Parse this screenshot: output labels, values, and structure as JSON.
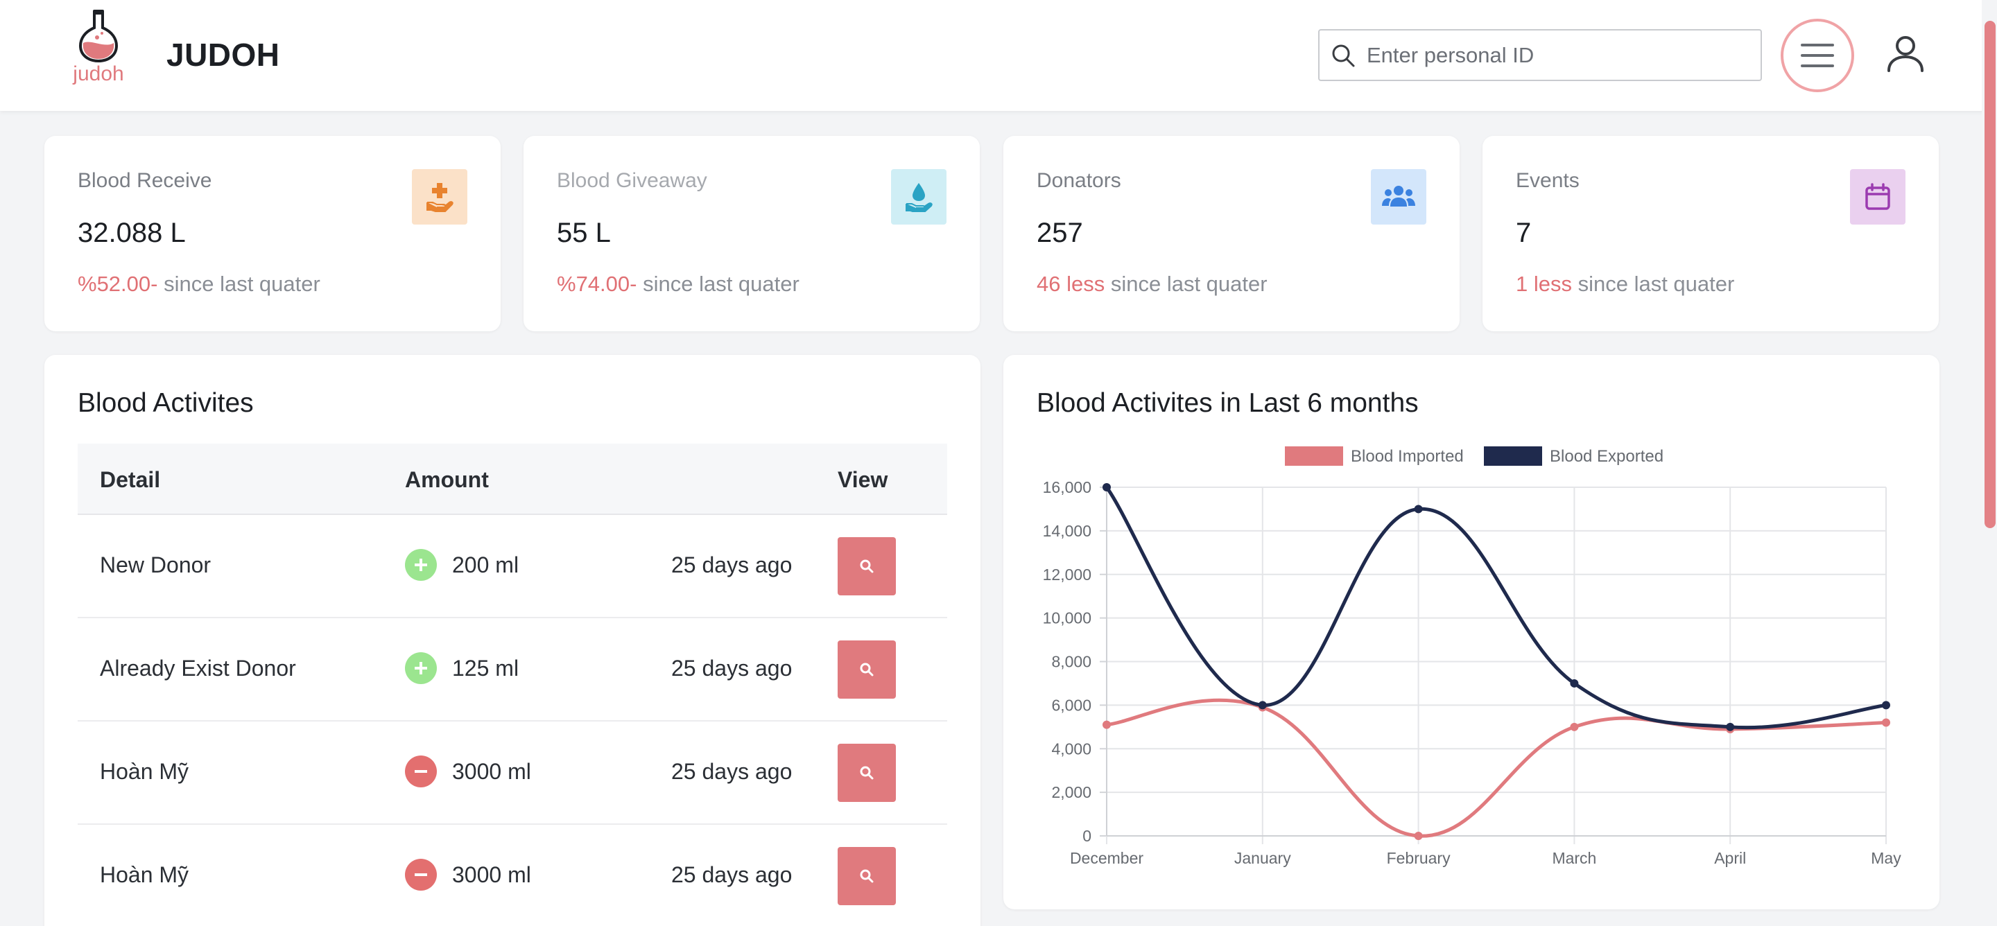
{
  "header": {
    "logo_text": "judoh",
    "brand": "JUDOH",
    "search_placeholder": "Enter personal ID"
  },
  "stats": [
    {
      "label": "Blood Receive",
      "value": "32.088 L",
      "delta": "%52.00-",
      "suffix": " since last quater",
      "icon": "hand-plus-icon",
      "badge_color": "#fbe1c8",
      "icon_color": "#e8832f",
      "label_color": "#7a7e85"
    },
    {
      "label": "Blood Giveaway",
      "value": "55 L",
      "delta": "%74.00-",
      "suffix": " since last quater",
      "icon": "hand-drop-icon",
      "badge_color": "#cfeef5",
      "icon_color": "#2aa3c4",
      "label_color": "#a6a9ae"
    },
    {
      "label": "Donators",
      "value": "257",
      "delta": "46 less",
      "suffix": " since last quater",
      "icon": "people-icon",
      "badge_color": "#d3e6fb",
      "icon_color": "#3b82e0",
      "label_color": "#7a7e85"
    },
    {
      "label": "Events",
      "value": "7",
      "delta": "1 less",
      "suffix": " since last quater",
      "icon": "calendar-icon",
      "badge_color": "#ead0ef",
      "icon_color": "#9b3bb0",
      "label_color": "#7a7e85"
    }
  ],
  "activities": {
    "title": "Blood Activites",
    "columns": {
      "detail": "Detail",
      "amount": "Amount",
      "view": "View"
    },
    "rows": [
      {
        "detail": "New Donor",
        "amount": "200 ml",
        "time": "25 days ago",
        "type": "plus"
      },
      {
        "detail": "Already Exist Donor",
        "amount": "125 ml",
        "time": "25 days ago",
        "type": "plus"
      },
      {
        "detail": "Hoàn Mỹ",
        "amount": "3000 ml",
        "time": "25 days ago",
        "type": "minus"
      },
      {
        "detail": "Hoàn Mỹ",
        "amount": "3000 ml",
        "time": "25 days ago",
        "type": "minus"
      }
    ]
  },
  "colors": {
    "accent": "#e07a7e",
    "navy": "#1f2a4d",
    "plus": "#9be58f",
    "minus": "#e36f6f"
  },
  "chart_data": {
    "type": "line",
    "title": "Blood Activites in Last 6 months",
    "categories": [
      "December",
      "January",
      "February",
      "March",
      "April",
      "May"
    ],
    "series": [
      {
        "name": "Blood Imported",
        "color": "#e07a7e",
        "values": [
          5100,
          5900,
          0,
          5000,
          4900,
          5200
        ]
      },
      {
        "name": "Blood Exported",
        "color": "#1f2a4d",
        "values": [
          16000,
          6000,
          15000,
          7000,
          5000,
          6000
        ]
      }
    ],
    "ylim": [
      0,
      16000
    ],
    "yticks": [
      "0",
      "2,000",
      "4,000",
      "6,000",
      "8,000",
      "10,000",
      "12,000",
      "14,000",
      "16,000"
    ],
    "legend": "top",
    "grid": true
  }
}
